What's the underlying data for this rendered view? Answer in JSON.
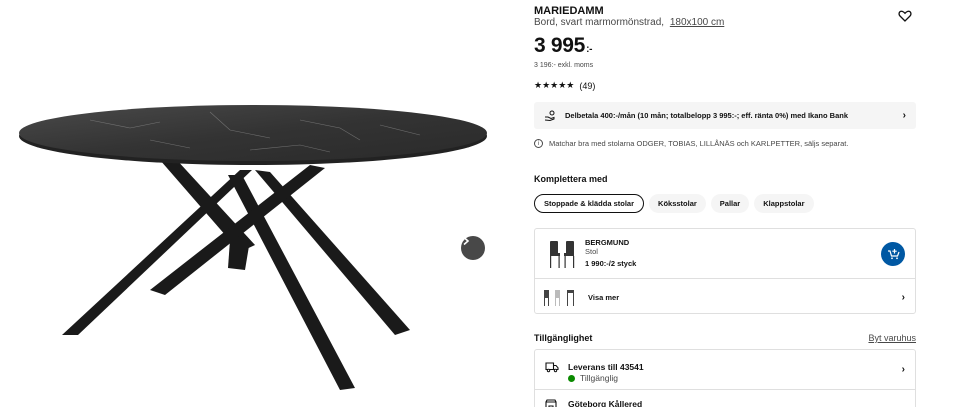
{
  "product": {
    "name": "MARIEDAMM",
    "description": "Bord, svart marmormönstrad,",
    "dimensions": "180x100 cm",
    "price_main": "3 995",
    "price_suffix": ":-",
    "price_ex_vat": "3 196:- exkl. moms",
    "rating_stars": "★★★★★",
    "rating_count": "(49)"
  },
  "financing": {
    "text": "Delbetala 400:-/mån (10 mån; totalbelopp 3 995:-; eff. ränta 0%) med Ikano Bank",
    "chevron": "›"
  },
  "match_note": {
    "icon": "i",
    "text": "Matchar bra med stolarna ODGER, TOBIAS, LILLÅNÄS och KARLPETTER, säljs separat."
  },
  "complete": {
    "label": "Komplettera med",
    "pills": [
      "Stoppade & klädda stolar",
      "Köksstolar",
      "Pallar",
      "Klappstolar"
    ]
  },
  "recommendation": {
    "name": "BERGMUND",
    "type": "Stol",
    "price": "1 990:-/2 styck",
    "more_label": "Visa mer",
    "chevron": "›"
  },
  "availability": {
    "label": "Tillgänglighet",
    "store_link": "Byt varuhus",
    "delivery_title": "Leverans till 43541",
    "delivery_status": "Tillgänglig",
    "store_name": "Göteborg Kållered",
    "chevron": "›"
  },
  "colors": {
    "accent_blue": "#0058a3",
    "available_green": "#0a8a00",
    "panel_gray": "#f5f5f5",
    "table_top": "#3a3a3a",
    "table_legs": "#1a1a1a"
  }
}
